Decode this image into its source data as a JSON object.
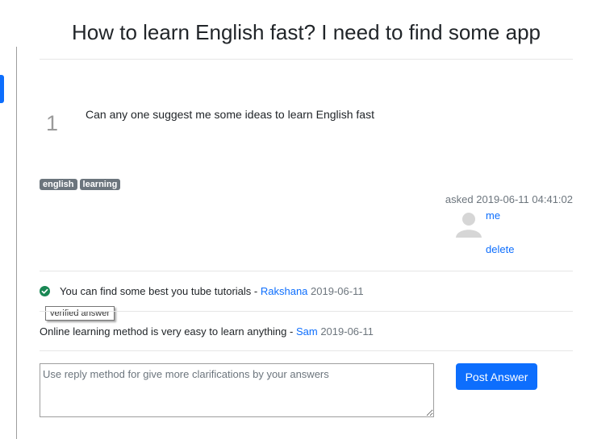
{
  "question": {
    "title": "How to learn English fast? I need to find some app",
    "votes": "1",
    "body": "Can any one suggest me some ideas to learn English fast",
    "tags": [
      "english",
      "learning"
    ],
    "asked_label": "asked",
    "asked_date": "2019-06-11 04:41:02",
    "user": "me",
    "delete_label": "delete"
  },
  "answers": [
    {
      "text": "You can find some best you tube tutorials",
      "separator": " - ",
      "author": "Rakshana",
      "date": "2019-06-11",
      "verified": true,
      "icon": "check-circle-icon",
      "tooltip": "verified answer"
    },
    {
      "text": "Online learning method is very easy to learn anything",
      "separator": " - ",
      "author": "Sam",
      "date": "2019-06-11",
      "verified": false
    }
  ],
  "reply": {
    "placeholder": "Use reply method for give more clarifications by your answers",
    "value": ""
  },
  "post_button": {
    "label": "Post Answer"
  },
  "colors": {
    "accent": "#0d6efd",
    "verified": "#198754",
    "tag_bg": "#6c757d"
  }
}
